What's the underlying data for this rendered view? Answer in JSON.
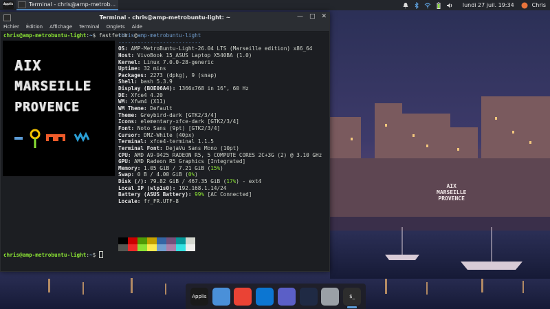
{
  "top_panel": {
    "apps_label": "Applis",
    "task_label": "Terminal - chris@amp-metrob...",
    "clock": "lundi 27 juil.  19:34",
    "user": "Chris"
  },
  "window": {
    "title": "Terminal - chris@amp-metrobuntu-light: ~",
    "menu": [
      "Fichier",
      "Édition",
      "Affichage",
      "Terminal",
      "Onglets",
      "Aide"
    ]
  },
  "terminal": {
    "prompt_user": "chris@amp-metrobuntu-light",
    "prompt_sep": ":",
    "prompt_path": "~",
    "prompt_end": "$ ",
    "command": "fastfetch",
    "header_user": "chris",
    "header_at": "@",
    "header_host": "amp-metrobuntu-light",
    "separator": "--------------------------",
    "logo_lines": [
      "AIX",
      "MARSEILLE",
      "PROVENCE"
    ],
    "info": [
      {
        "key": "OS",
        "value": "AMP-MetroBuntu-Light-26.04 LTS (Marseille edition) x86_64"
      },
      {
        "key": "Host",
        "value": "VivoBook 15_ASUS Laptop X540BA (1.0)"
      },
      {
        "key": "Kernel",
        "value": "Linux 7.0.0-28-generic"
      },
      {
        "key": "Uptime",
        "value": "32 mins"
      },
      {
        "key": "Packages",
        "value": "2273 (dpkg), 9 (snap)"
      },
      {
        "key": "Shell",
        "value": "bash 5.3.9"
      },
      {
        "key": "Display (BOE06A4)",
        "value": "1366x768 in 16\", 60 Hz"
      },
      {
        "key": "DE",
        "value": "Xfce4 4.20"
      },
      {
        "key": "WM",
        "value": "Xfwm4 (X11)"
      },
      {
        "key": "WM Theme",
        "value": "Default"
      },
      {
        "key": "Theme",
        "value": "Greybird-dark [GTK2/3/4]"
      },
      {
        "key": "Icons",
        "value": "elementary-xfce-dark [GTK2/3/4]"
      },
      {
        "key": "Font",
        "value": "Noto Sans (9pt) [GTK2/3/4]"
      },
      {
        "key": "Cursor",
        "value": "DMZ-White (40px)"
      },
      {
        "key": "Terminal",
        "value": "xfce4-terminal 1.1.5"
      },
      {
        "key": "Terminal Font",
        "value": "DejaVu Sans Mono (10pt)"
      },
      {
        "key": "CPU",
        "value": "AMD A9-9425 RADEON R5, 5 COMPUTE CORES 2C+3G (2) @ 3.10 GHz"
      },
      {
        "key": "GPU",
        "value": "AMD Radeon R5 Graphics [Integrated]"
      }
    ],
    "memory": {
      "key": "Memory",
      "value": "1.05 GiB / 7.21 GiB (",
      "pct": "15%",
      "end": ")"
    },
    "swap": {
      "key": "Swap",
      "value": "0 B / 4.00 GiB (",
      "pct": "0%",
      "end": ")"
    },
    "disk": {
      "key": "Disk (/)",
      "value": "79.82 GiB / 467.35 GiB (",
      "pct": "17%",
      "end": ") - ext4"
    },
    "local_ip": {
      "key": "Local IP (wlp1s0)",
      "value": "192.168.1.14/24"
    },
    "battery": {
      "key": "Battery (ASUS Battery)",
      "pct": "99%",
      "value": " [AC Connected]"
    },
    "locale": {
      "key": "Locale",
      "value": "fr_FR.UTF-8"
    },
    "palette_top": [
      "#000000",
      "#cc0000",
      "#4e9a06",
      "#c4a000",
      "#3465a4",
      "#75507b",
      "#06989a",
      "#d3d7cf"
    ],
    "palette_bottom": [
      "#555753",
      "#ef2929",
      "#8ae234",
      "#fce94f",
      "#729fcf",
      "#ad7fa8",
      "#34e2e2",
      "#eeeeec"
    ]
  },
  "dock": {
    "items": [
      {
        "name": "applis",
        "label": "Applis",
        "color": "#1a1a1a"
      },
      {
        "name": "files",
        "label": "",
        "color": "#4a90d9"
      },
      {
        "name": "chrome",
        "label": "",
        "color": "#ea4335"
      },
      {
        "name": "edge",
        "label": "",
        "color": "#0c76d2"
      },
      {
        "name": "teams",
        "label": "",
        "color": "#5b5fc7"
      },
      {
        "name": "warp",
        "label": "",
        "color": "#1f2a44"
      },
      {
        "name": "trash",
        "label": "",
        "color": "#9aa0a6"
      },
      {
        "name": "terminal",
        "label": "$_",
        "color": "#2d2d2d"
      }
    ]
  },
  "wallpaper_sign": [
    "AIX",
    "MARSEILLE",
    "PROVENCE"
  ]
}
